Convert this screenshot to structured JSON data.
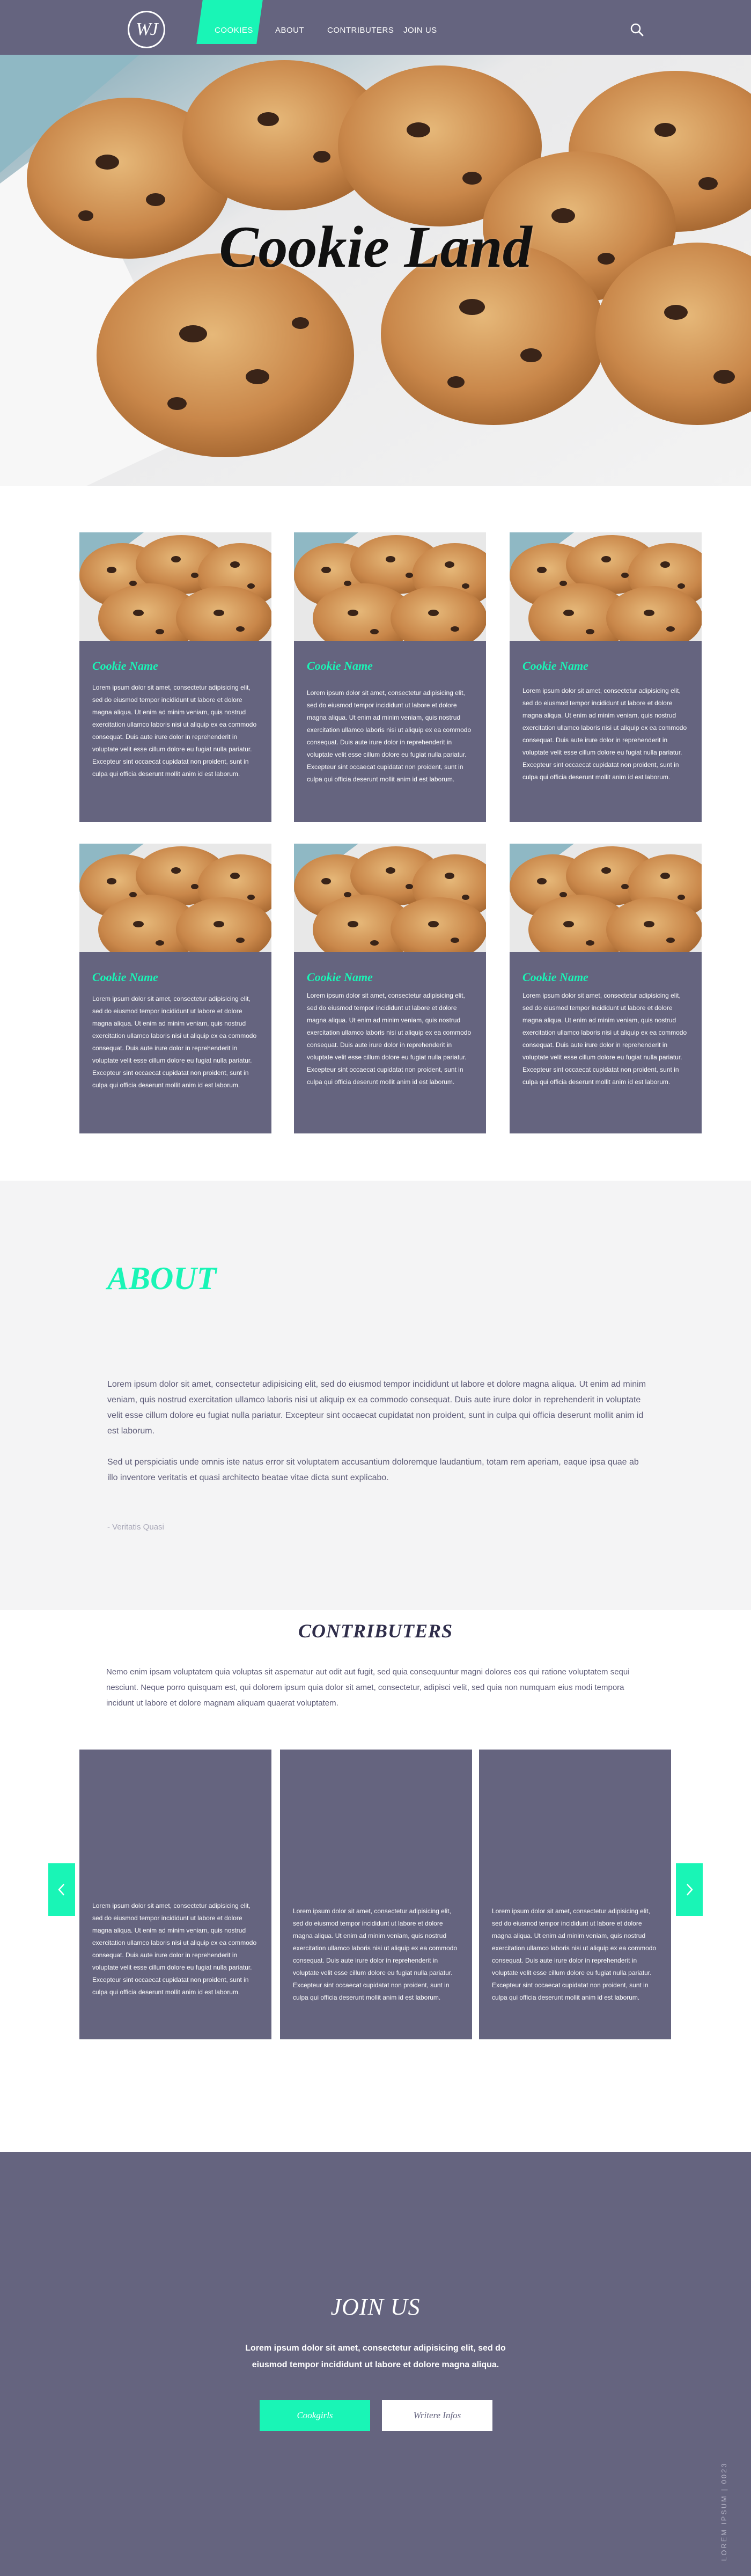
{
  "nav": {
    "logo_text": "WJ",
    "items": [
      "COOKIES",
      "ABOUT",
      "CONTRIBUTERS",
      "JOIN US"
    ],
    "active_item": "COOKIES",
    "search_icon": "search-icon",
    "accent_color": "#19f5b6",
    "bar_color": "#65647f"
  },
  "hero": {
    "title": "Cookie Land",
    "image": "chocolate chip cookies photo"
  },
  "cookies": {
    "cards": [
      {
        "title": "Cookie Name",
        "text": "Lorem ipsum dolor sit amet, consectetur adipisicing elit, sed do eiusmod tempor incididunt ut labore et dolore magna aliqua. Ut enim ad minim veniam, quis nostrud exercitation ullamco laboris nisi ut aliquip ex ea commodo consequat. Duis aute irure dolor in reprehenderit in voluptate velit esse cillum dolore eu fugiat nulla pariatur. Excepteur sint occaecat cupidatat non proident, sunt in culpa qui officia deserunt mollit anim id est laborum."
      },
      {
        "title": "Cookie Name",
        "text": "Lorem ipsum dolor sit amet, consectetur adipisicing elit, sed do eiusmod tempor incididunt ut labore et dolore magna aliqua. Ut enim ad minim veniam, quis nostrud exercitation ullamco laboris nisi ut aliquip ex ea commodo consequat. Duis aute irure dolor in reprehenderit in voluptate velit esse cillum dolore eu fugiat nulla pariatur. Excepteur sint occaecat cupidatat non proident, sunt in culpa qui officia deserunt mollit anim id est laborum."
      },
      {
        "title": "Cookie Name",
        "text": "Lorem ipsum dolor sit amet, consectetur adipisicing elit, sed do eiusmod tempor incididunt ut labore et dolore magna aliqua. Ut enim ad minim veniam, quis nostrud exercitation ullamco laboris nisi ut aliquip ex ea commodo consequat. Duis aute irure dolor in reprehenderit in voluptate velit esse cillum dolore eu fugiat nulla pariatur. Excepteur sint occaecat cupidatat non proident, sunt in culpa qui officia deserunt mollit anim id est laborum."
      },
      {
        "title": "Cookie Name",
        "text": "Lorem ipsum dolor sit amet, consectetur adipisicing elit, sed do eiusmod tempor incididunt ut labore et dolore magna aliqua. Ut enim ad minim veniam, quis nostrud exercitation ullamco laboris nisi ut aliquip ex ea commodo consequat. Duis aute irure dolor in reprehenderit in voluptate velit esse cillum dolore eu fugiat nulla pariatur. Excepteur sint occaecat cupidatat non proident, sunt in culpa qui officia deserunt mollit anim id est laborum."
      },
      {
        "title": "Cookie Name",
        "text": "Lorem ipsum dolor sit amet, consectetur adipisicing elit, sed do eiusmod tempor incididunt ut labore et dolore magna aliqua. Ut enim ad minim veniam, quis nostrud exercitation ullamco laboris nisi ut aliquip ex ea commodo consequat. Duis aute irure dolor in reprehenderit in voluptate velit esse cillum dolore eu fugiat nulla pariatur. Excepteur sint occaecat cupidatat non proident, sunt in culpa qui officia deserunt mollit anim id est laborum."
      },
      {
        "title": "Cookie Name",
        "text": "Lorem ipsum dolor sit amet, consectetur adipisicing elit, sed do eiusmod tempor incididunt ut labore et dolore magna aliqua. Ut enim ad minim veniam, quis nostrud exercitation ullamco laboris nisi ut aliquip ex ea commodo consequat. Duis aute irure dolor in reprehenderit in voluptate velit esse cillum dolore eu fugiat nulla pariatur. Excepteur sint occaecat cupidatat non proident, sunt in culpa qui officia deserunt mollit anim id est laborum."
      }
    ]
  },
  "about": {
    "title": "ABOUT",
    "paragraph1": "Lorem ipsum dolor sit amet, consectetur adipisicing elit, sed do eiusmod tempor incididunt ut labore et dolore magna aliqua. Ut enim ad minim veniam, quis nostrud exercitation ullamco laboris nisi ut aliquip ex ea commodo consequat. Duis aute irure dolor in reprehenderit in voluptate velit esse cillum dolore eu fugiat nulla pariatur. Excepteur sint occaecat cupidatat non proident, sunt in culpa qui officia deserunt mollit anim id est laborum.",
    "paragraph2": "Sed ut perspiciatis unde omnis iste natus error sit voluptatem accusantium doloremque laudantium, totam rem aperiam, eaque ipsa quae ab illo inventore veritatis et quasi architecto beatae vitae dicta sunt explicabo.",
    "signature": "- Veritatis Quasi"
  },
  "contributers": {
    "title": "CONTRIBUTERS",
    "intro": "Nemo enim ipsam voluptatem quia voluptas sit aspernatur aut odit aut fugit, sed quia consequuntur magni dolores eos qui ratione voluptatem sequi nesciunt. Neque porro quisquam est, qui dolorem ipsum quia dolor sit amet, consectetur, adipisci velit, sed quia non numquam eius modi tempora incidunt ut labore et dolore magnam aliquam quaerat voluptatem.",
    "cards": [
      {
        "text": "Lorem ipsum dolor sit amet, consectetur adipisicing elit, sed do eiusmod tempor incididunt ut labore et dolore magna aliqua. Ut enim ad minim veniam, quis nostrud exercitation ullamco laboris nisi ut aliquip ex ea commodo consequat. Duis aute irure dolor in reprehenderit in voluptate velit esse cillum dolore eu fugiat nulla pariatur. Excepteur sint occaecat cupidatat non proident, sunt in culpa qui officia deserunt mollit anim id est laborum."
      },
      {
        "text": "Lorem ipsum dolor sit amet, consectetur adipisicing elit, sed do eiusmod tempor incididunt ut labore et dolore magna aliqua. Ut enim ad minim veniam, quis nostrud exercitation ullamco laboris nisi ut aliquip ex ea commodo consequat. Duis aute irure dolor in reprehenderit in voluptate velit esse cillum dolore eu fugiat nulla pariatur. Excepteur sint occaecat cupidatat non proident, sunt in culpa qui officia deserunt mollit anim id est laborum."
      },
      {
        "text": "Lorem ipsum dolor sit amet, consectetur adipisicing elit, sed do eiusmod tempor incididunt ut labore et dolore magna aliqua. Ut enim ad minim veniam, quis nostrud exercitation ullamco laboris nisi ut aliquip ex ea commodo consequat. Duis aute irure dolor in reprehenderit in voluptate velit esse cillum dolore eu fugiat nulla pariatur. Excepteur sint occaecat cupidatat non proident, sunt in culpa qui officia deserunt mollit anim id est laborum."
      }
    ],
    "prev_icon": "chevron-left-icon",
    "next_icon": "chevron-right-icon"
  },
  "join": {
    "title": "JOIN US",
    "text": "Lorem ipsum dolor sit amet, consectetur adipisicing elit, sed do eiusmod tempor incididunt ut labore et dolore magna aliqua.",
    "primary_button": "Cookgirls",
    "secondary_button": "Writere Infos",
    "side_text": "LOREM IPSUM | 0023"
  }
}
